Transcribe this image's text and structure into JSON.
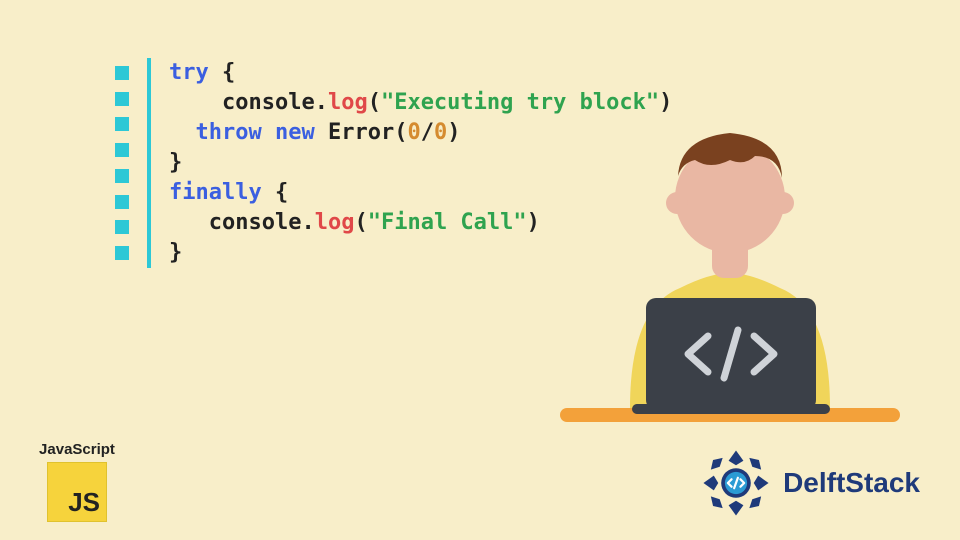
{
  "code": {
    "lines": [
      [
        {
          "cls": "kw",
          "t": "try"
        },
        {
          "cls": "punc",
          "t": " {"
        }
      ],
      [
        {
          "cls": "punc",
          "t": "    "
        },
        {
          "cls": "obj",
          "t": "console"
        },
        {
          "cls": "dot2",
          "t": "."
        },
        {
          "cls": "fn",
          "t": "log"
        },
        {
          "cls": "punc",
          "t": "("
        },
        {
          "cls": "str",
          "t": "\"Executing try block\""
        },
        {
          "cls": "punc",
          "t": ")"
        }
      ],
      [
        {
          "cls": "punc",
          "t": "  "
        },
        {
          "cls": "kw",
          "t": "throw"
        },
        {
          "cls": "punc",
          "t": " "
        },
        {
          "cls": "new",
          "t": "new"
        },
        {
          "cls": "punc",
          "t": " "
        },
        {
          "cls": "err",
          "t": "Error"
        },
        {
          "cls": "punc",
          "t": "("
        },
        {
          "cls": "num",
          "t": "0"
        },
        {
          "cls": "punc",
          "t": "/"
        },
        {
          "cls": "num",
          "t": "0"
        },
        {
          "cls": "punc",
          "t": ")"
        }
      ],
      [
        {
          "cls": "punc",
          "t": "}"
        }
      ],
      [
        {
          "cls": "kw",
          "t": "finally"
        },
        {
          "cls": "punc",
          "t": " {"
        }
      ],
      [
        {
          "cls": "punc",
          "t": "   "
        },
        {
          "cls": "obj",
          "t": "console"
        },
        {
          "cls": "dot2",
          "t": "."
        },
        {
          "cls": "fn",
          "t": "log"
        },
        {
          "cls": "punc",
          "t": "("
        },
        {
          "cls": "str",
          "t": "\"Final Call\""
        },
        {
          "cls": "punc",
          "t": ")"
        }
      ],
      [
        {
          "cls": "punc",
          "t": "}"
        }
      ]
    ]
  },
  "js_badge": {
    "title": "JavaScript",
    "logo_text": "JS"
  },
  "delftstack": {
    "name": "DelftStack"
  },
  "colors": {
    "bg": "#f8eec9",
    "accent": "#2dc8d6",
    "keyword": "#3b5fe0",
    "function": "#e04848",
    "string": "#2fa34f",
    "number": "#d58b2f",
    "delft": "#1f3a7a",
    "desk": "#f3a13a",
    "skin": "#e9b7a3",
    "hair": "#7a411f",
    "shirt": "#f0d55a",
    "laptop": "#3b4048"
  }
}
